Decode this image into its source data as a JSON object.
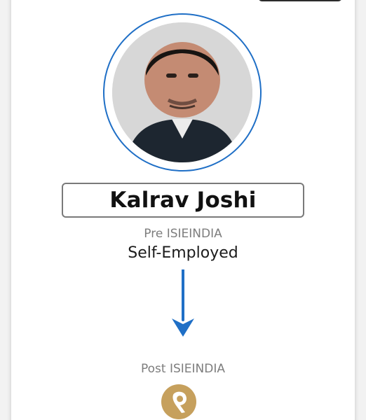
{
  "profile": {
    "name": "Kalrav Joshi",
    "pre_label": "Pre ISIEINDIA",
    "pre_value": "Self-Employed",
    "post_label": "Post ISIEINDIA"
  },
  "colors": {
    "accent": "#1f6fc6",
    "logo_gold": "#c6a05d"
  },
  "icons": {
    "arrow": "arrow-down-icon",
    "company_logo": "company-logo-icon"
  }
}
